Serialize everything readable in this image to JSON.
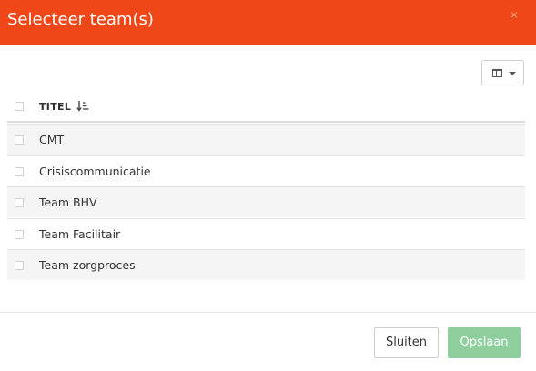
{
  "dialog": {
    "title": "Selecteer team(s)",
    "close_symbol": "×",
    "header_color": "#f04719"
  },
  "toolbar": {
    "columns_icon": "columns-icon",
    "dropdown_icon": "caret-down-icon"
  },
  "table": {
    "header": {
      "title": "TITEL",
      "sort_icon": "sort-ascending-icon"
    },
    "rows": [
      {
        "title": "CMT"
      },
      {
        "title": "Crisiscommunicatie"
      },
      {
        "title": "Team BHV"
      },
      {
        "title": "Team Facilitair"
      },
      {
        "title": "Team zorgproces"
      }
    ]
  },
  "footer": {
    "close_label": "Sluiten",
    "save_label": "Opslaan",
    "save_color": "#8fcf9d"
  }
}
